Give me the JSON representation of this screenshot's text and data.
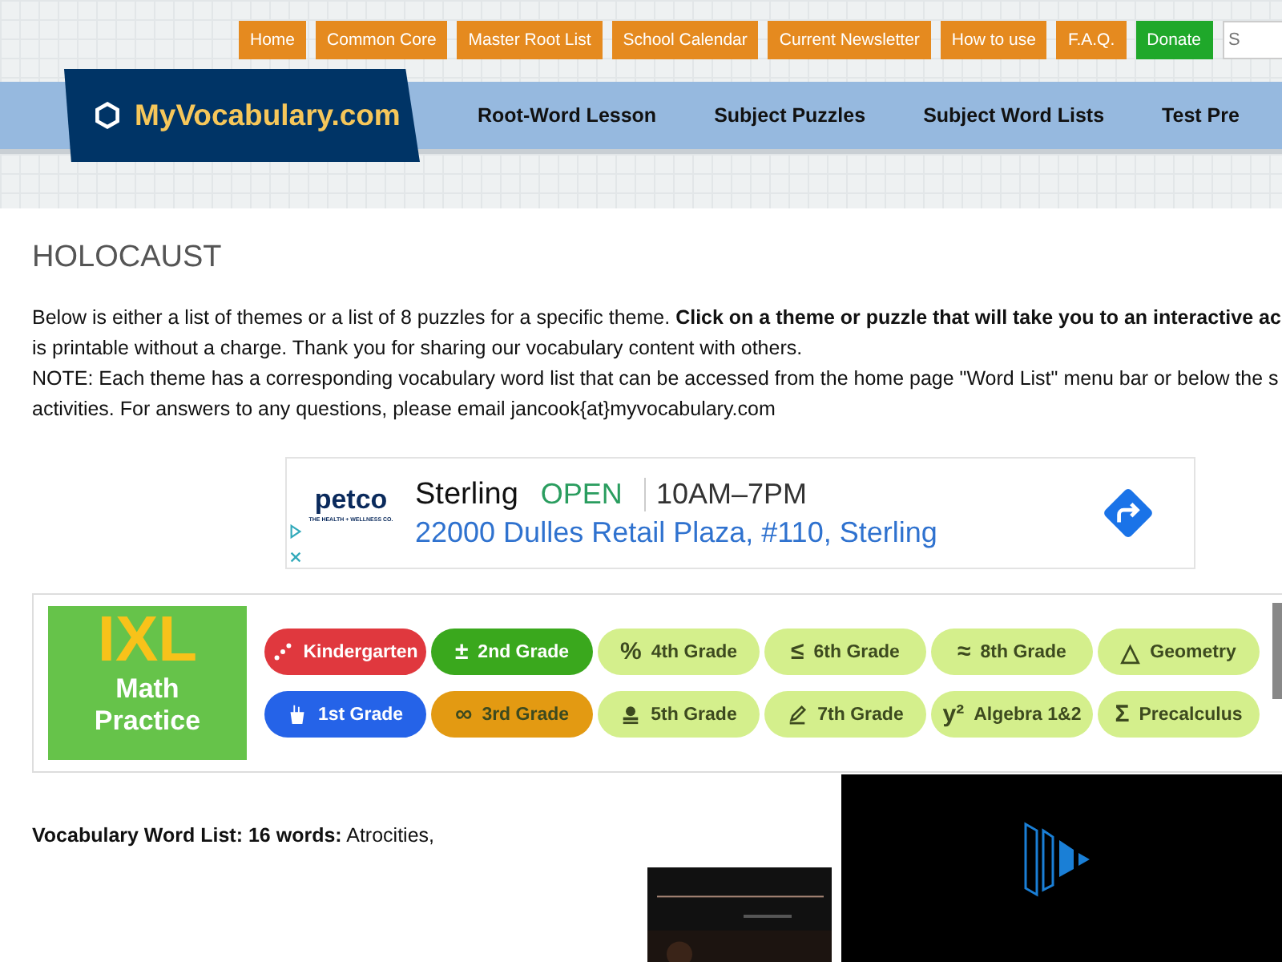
{
  "top_nav": [
    {
      "label": "Home",
      "kind": "link"
    },
    {
      "label": "Common Core",
      "kind": "link"
    },
    {
      "label": "Master Root List",
      "kind": "link"
    },
    {
      "label": "School Calendar",
      "kind": "link"
    },
    {
      "label": "Current Newsletter",
      "kind": "link"
    },
    {
      "label": "How to use",
      "kind": "link"
    },
    {
      "label": "F.A.Q.",
      "kind": "link"
    },
    {
      "label": "Donate",
      "kind": "donate"
    }
  ],
  "search": {
    "placeholder": "S"
  },
  "logo": "MyVocabulary.com",
  "main_nav": [
    "Root-Word Lesson",
    "Subject Puzzles",
    "Subject Word Lists",
    "Test Pre"
  ],
  "heading": "HOLOCAUST",
  "intro_lines": [
    "Below is either a list of themes or a list of 8 puzzles for a specific theme. **Click on a theme or puzzle that will take you to an interactive ac**",
    "is printable without a charge. Thank you for sharing our vocabulary content with others.",
    "NOTE: Each theme has a corresponding vocabulary word list that can be accessed from the home page \"Word List\" menu bar or below the s",
    "activities. For answers to any questions, please email jancook{at}myvocabulary.com"
  ],
  "ad": {
    "brand": "petco",
    "tagline": "THE HEALTH + WELLNESS CO.",
    "store": "Sterling",
    "status": "OPEN",
    "hours": "10AM–7PM",
    "address": "22000 Dulles Retail Plaza, #110, Sterling"
  },
  "banner": {
    "logo": "IXL",
    "subject_top": "Math",
    "subject_bottom": "Practice",
    "chips": [
      {
        "label": "Kindergarten",
        "color": "#e0383e"
      },
      {
        "symbol": "±",
        "label": "2nd Grade",
        "color": "#3aa81d"
      },
      {
        "symbol": "%",
        "label": "4th Grade",
        "color": "#d4ef8c"
      },
      {
        "symbol": "≤",
        "label": "6th Grade",
        "color": "#d4ef8c"
      },
      {
        "symbol": "≈",
        "label": "8th Grade",
        "color": "#d4ef8c"
      },
      {
        "symbol": "△",
        "label": "Geometry",
        "color": "#d4ef8c"
      },
      {
        "label": "1st Grade",
        "color": "#2563e8"
      },
      {
        "symbol": "∞",
        "label": "3rd Grade",
        "color": "#e39a12"
      },
      {
        "label": "5th Grade",
        "color": "#d4ef8c"
      },
      {
        "label": "7th Grade",
        "color": "#d4ef8c"
      },
      {
        "symbol": "y²",
        "label": "Algebra 1&2",
        "color": "#d4ef8c"
      },
      {
        "symbol": "Σ",
        "label": "Precalculus",
        "color": "#d4ef8c"
      }
    ]
  },
  "word_list": "**Vocabulary Word List: 16 words:** Atrocities,",
  "video": {
    "kind": "player"
  }
}
